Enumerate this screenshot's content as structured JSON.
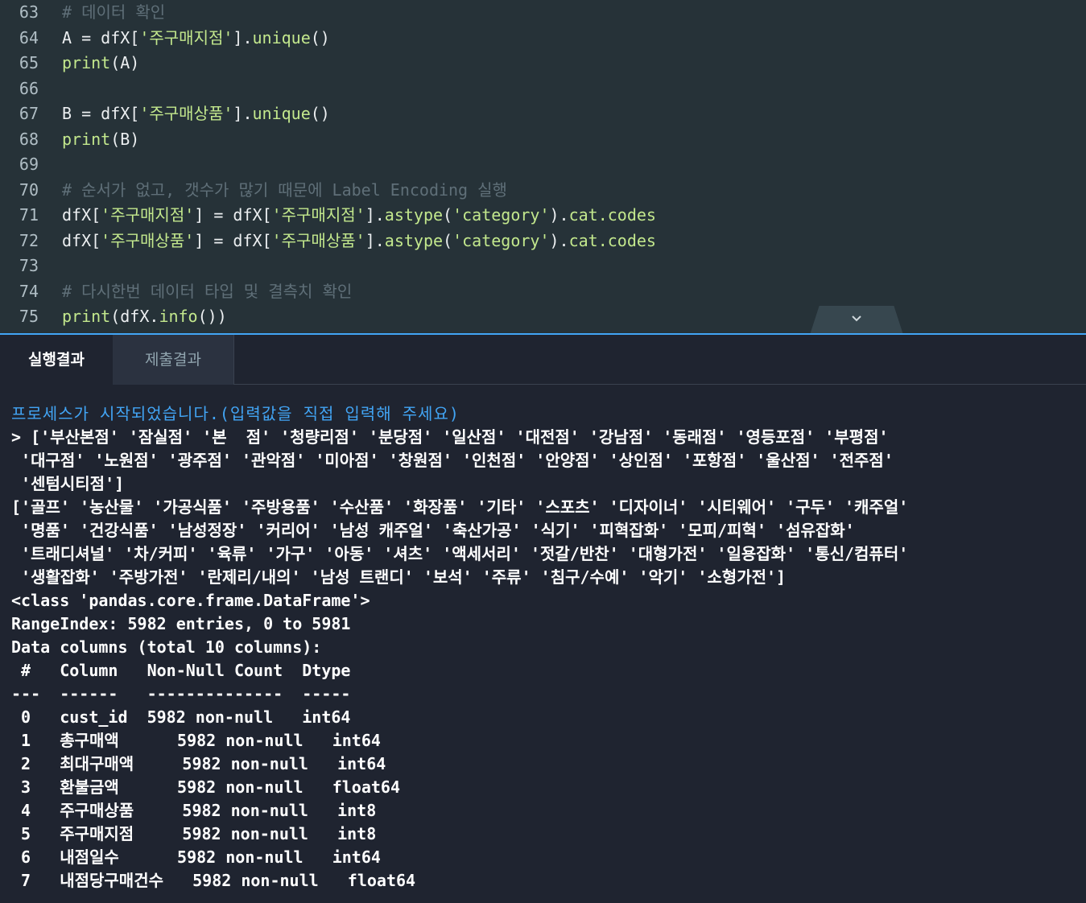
{
  "editor": {
    "lines": [
      {
        "num": "63",
        "parts": [
          [
            "cm",
            "# 데이터 확인"
          ]
        ]
      },
      {
        "num": "64",
        "parts": [
          [
            "pl",
            "A = dfX["
          ],
          [
            "st",
            "'주구매지점'"
          ],
          [
            "pl",
            "]."
          ],
          [
            "fn",
            "unique"
          ],
          [
            "pl",
            "()"
          ]
        ]
      },
      {
        "num": "65",
        "parts": [
          [
            "fn",
            "print"
          ],
          [
            "pl",
            "(A)"
          ]
        ]
      },
      {
        "num": "66",
        "parts": []
      },
      {
        "num": "67",
        "parts": [
          [
            "pl",
            "B = dfX["
          ],
          [
            "st",
            "'주구매상품'"
          ],
          [
            "pl",
            "]."
          ],
          [
            "fn",
            "unique"
          ],
          [
            "pl",
            "()"
          ]
        ]
      },
      {
        "num": "68",
        "parts": [
          [
            "fn",
            "print"
          ],
          [
            "pl",
            "(B)"
          ]
        ]
      },
      {
        "num": "69",
        "parts": []
      },
      {
        "num": "70",
        "parts": [
          [
            "cm",
            "# 순서가 없고, 갯수가 많기 때문에 Label Encoding 실행"
          ]
        ]
      },
      {
        "num": "71",
        "parts": [
          [
            "pl",
            "dfX["
          ],
          [
            "st",
            "'주구매지점'"
          ],
          [
            "pl",
            "] = dfX["
          ],
          [
            "st",
            "'주구매지점'"
          ],
          [
            "pl",
            "]."
          ],
          [
            "fn",
            "astype"
          ],
          [
            "pl",
            "("
          ],
          [
            "st",
            "'category'"
          ],
          [
            "pl",
            ")."
          ],
          [
            "fn",
            "cat.codes"
          ]
        ]
      },
      {
        "num": "72",
        "parts": [
          [
            "pl",
            "dfX["
          ],
          [
            "st",
            "'주구매상품'"
          ],
          [
            "pl",
            "] = dfX["
          ],
          [
            "st",
            "'주구매상품'"
          ],
          [
            "pl",
            "]."
          ],
          [
            "fn",
            "astype"
          ],
          [
            "pl",
            "("
          ],
          [
            "st",
            "'category'"
          ],
          [
            "pl",
            ")."
          ],
          [
            "fn",
            "cat.codes"
          ]
        ]
      },
      {
        "num": "73",
        "parts": []
      },
      {
        "num": "74",
        "parts": [
          [
            "cm",
            "# 다시한번 데이터 타입 및 결측치 확인"
          ]
        ]
      },
      {
        "num": "75",
        "parts": [
          [
            "fn",
            "print"
          ],
          [
            "pl",
            "(dfX."
          ],
          [
            "fn",
            "info"
          ],
          [
            "pl",
            "())"
          ]
        ]
      }
    ]
  },
  "tabs": {
    "result": "실행결과",
    "submit": "제출결과"
  },
  "output": {
    "start": "프로세스가 시작되었습니다.(입력값을 직접 입력해 주세요)",
    "lines": [
      "> ['부산본점' '잠실점' '본  점' '청량리점' '분당점' '일산점' '대전점' '강남점' '동래점' '영등포점' '부평점'",
      " '대구점' '노원점' '광주점' '관악점' '미아점' '창원점' '인천점' '안양점' '상인점' '포항점' '울산점' '전주점'",
      " '센텀시티점']",
      "['골프' '농산물' '가공식품' '주방용품' '수산품' '화장품' '기타' '스포츠' '디자이너' '시티웨어' '구두' '캐주얼'",
      " '명품' '건강식품' '남성정장' '커리어' '남성 캐주얼' '축산가공' '식기' '피혁잡화' '모피/피혁' '섬유잡화'",
      " '트래디셔널' '차/커피' '육류' '가구' '아동' '셔츠' '액세서리' '젓갈/반찬' '대형가전' '일용잡화' '통신/컴퓨터'",
      " '생활잡화' '주방가전' '란제리/내의' '남성 트랜디' '보석' '주류' '침구/수예' '악기' '소형가전']",
      "<class 'pandas.core.frame.DataFrame'>",
      "RangeIndex: 5982 entries, 0 to 5981",
      "Data columns (total 10 columns):",
      " #   Column   Non-Null Count  Dtype",
      "---  ------   --------------  -----",
      " 0   cust_id  5982 non-null   int64",
      " 1   총구매액      5982 non-null   int64",
      " 2   최대구매액     5982 non-null   int64",
      " 3   환불금액      5982 non-null   float64",
      " 4   주구매상품     5982 non-null   int8",
      " 5   주구매지점     5982 non-null   int8",
      " 6   내점일수      5982 non-null   int64",
      " 7   내점당구매건수   5982 non-null   float64"
    ]
  },
  "colors": {
    "editor_bg": "#263238",
    "panel_bg": "#1f2430",
    "accent": "#42a5f5",
    "string": "#c3e88d",
    "comment": "#5f6f78"
  }
}
